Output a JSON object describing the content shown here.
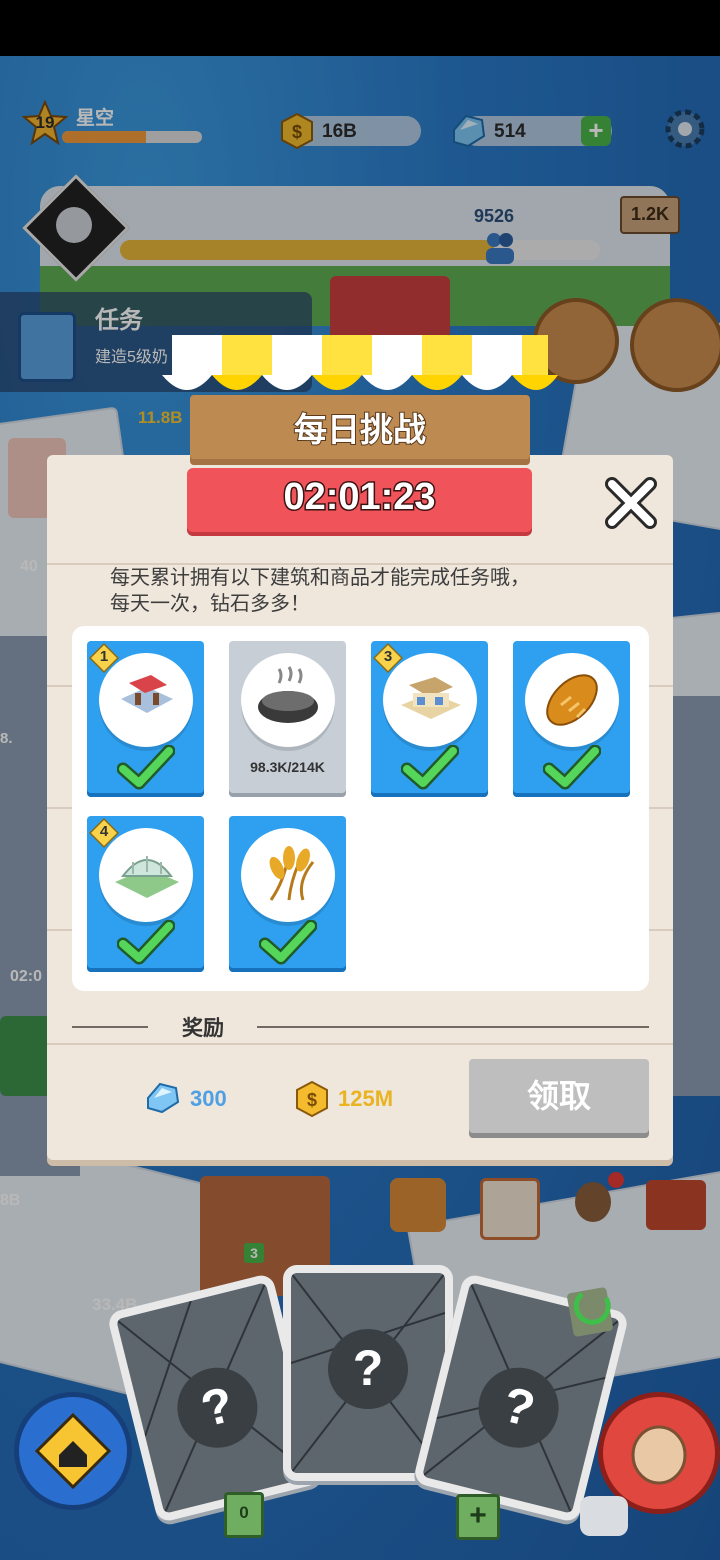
{
  "hud": {
    "player_level": "19",
    "player_name": "星空",
    "coins": "16B",
    "gems": "514",
    "population": "9526",
    "milestone": "1.2K"
  },
  "task_panel": {
    "title": "任务",
    "subtitle": "建造5级奶",
    "income": "11.8B"
  },
  "side_values": {
    "left_count": "40",
    "timer_partial": "02:0",
    "bottom_left": "8B",
    "plot_price": "33.4B",
    "plot_level": "3",
    "left_edge": "8."
  },
  "popup": {
    "title": "每日挑战",
    "timer": "02:01:23",
    "description_line1": "每天累计拥有以下建筑和商品才能完成任务哦，",
    "description_line2": "每天一次，钻石多多！",
    "items": [
      {
        "icon": "restaurant-building-icon",
        "level": "1",
        "status": "done"
      },
      {
        "icon": "hotpot-icon",
        "level": "",
        "status": "pending",
        "progress": "98.3K/214K"
      },
      {
        "icon": "shop-building-icon",
        "level": "3",
        "status": "done"
      },
      {
        "icon": "bread-icon",
        "level": "",
        "status": "done"
      },
      {
        "icon": "greenhouse-building-icon",
        "level": "4",
        "status": "done"
      },
      {
        "icon": "wheat-icon",
        "level": "",
        "status": "done"
      }
    ],
    "reward_label": "奖励",
    "reward_gems": "300",
    "reward_coins": "125M",
    "claim_button": "领取"
  },
  "bottom": {
    "card_counter": "0"
  },
  "colors": {
    "timer_bg": "#f0535a",
    "done_card": "#2fa0ef",
    "pending_card": "#c7ced6",
    "claim_disabled": "#bebebe",
    "panel_bg": "#efe6dc"
  }
}
